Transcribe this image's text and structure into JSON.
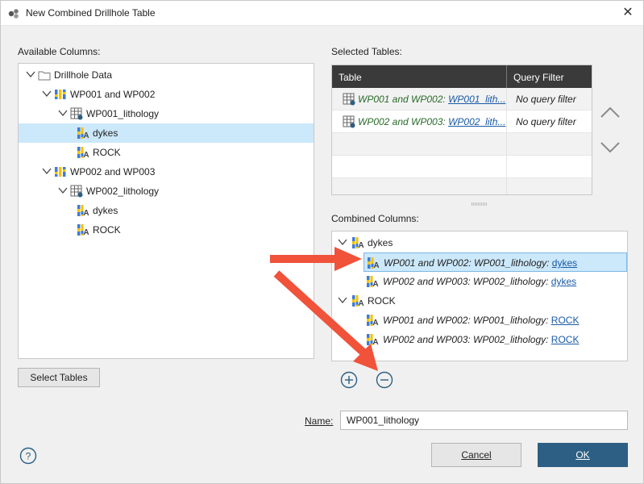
{
  "window": {
    "title": "New Combined Drillhole Table",
    "close_glyph": "✕"
  },
  "available": {
    "label": "Available Columns:",
    "tree": [
      {
        "label": "Drillhole Data",
        "icon": "folder-icon",
        "level": 0,
        "expanded": true
      },
      {
        "label": "WP001 and WP002",
        "icon": "drillhole-group-icon",
        "level": 1,
        "expanded": true
      },
      {
        "label": "WP001_lithology",
        "icon": "table-icon",
        "level": 2,
        "expanded": true
      },
      {
        "label": "dykes",
        "icon": "category-column-icon",
        "level": 3,
        "selected": true
      },
      {
        "label": "ROCK",
        "icon": "category-column-icon",
        "level": 3
      },
      {
        "label": "WP002 and WP003",
        "icon": "drillhole-group-icon",
        "level": 1,
        "expanded": true
      },
      {
        "label": "WP002_lithology",
        "icon": "table-icon",
        "level": 2,
        "expanded": true
      },
      {
        "label": "dykes",
        "icon": "category-column-icon",
        "level": 3
      },
      {
        "label": "ROCK",
        "icon": "category-column-icon",
        "level": 3
      }
    ],
    "select_tables_button": "Select Tables"
  },
  "selected_tables": {
    "label": "Selected Tables:",
    "col_table": "Table",
    "col_filter": "Query Filter",
    "rows": [
      {
        "prefix": "WP001 and WP002: ",
        "link": "WP001_lith...",
        "filter": "No query filter"
      },
      {
        "prefix": "WP002 and WP003: ",
        "link": "WP002_lith...",
        "filter": "No query filter"
      }
    ]
  },
  "combined": {
    "label": "Combined Columns:",
    "groups": [
      {
        "label": "dykes",
        "items": [
          {
            "prefix": "WP001 and WP002: WP001_lithology: ",
            "link": "dykes",
            "selected": true
          },
          {
            "prefix": "WP002 and WP003: WP002_lithology: ",
            "link": "dykes"
          }
        ]
      },
      {
        "label": "ROCK",
        "items": [
          {
            "prefix": "WP001 and WP002: WP001_lithology: ",
            "link": "ROCK"
          },
          {
            "prefix": "WP002 and WP003: WP002_lithology: ",
            "link": "ROCK"
          }
        ]
      }
    ]
  },
  "name": {
    "label": "Name:",
    "value": "WP001_lithology"
  },
  "buttons": {
    "cancel": "Cancel",
    "ok": "OK",
    "help": "?"
  },
  "colors": {
    "accent": "#2c5f83",
    "selection": "#cce8fb",
    "annotation_arrow": "#f0523a",
    "link": "#1a5aa6",
    "green_text": "#2a7a1f"
  }
}
